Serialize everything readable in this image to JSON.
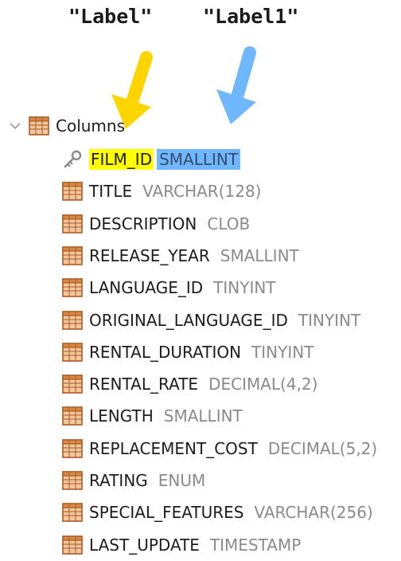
{
  "annotations": {
    "label_left": "\"Label\"",
    "label_right": "\"Label1\""
  },
  "colors": {
    "yellow_arrow": "#ffd400",
    "blue_arrow": "#6fb7ff",
    "yellow_highlight": "#ffff00",
    "blue_highlight": "#6fb7ff",
    "type_text": "#8a8a8a"
  },
  "tree": {
    "root_label": "Columns",
    "root_icon": "table-icon",
    "expanded": true,
    "columns": [
      {
        "name": "FILM_ID",
        "type": "SMALLINT",
        "icon": "key-icon"
      },
      {
        "name": "TITLE",
        "type": "VARCHAR(128)",
        "icon": "column-icon"
      },
      {
        "name": "DESCRIPTION",
        "type": "CLOB",
        "icon": "column-icon"
      },
      {
        "name": "RELEASE_YEAR",
        "type": "SMALLINT",
        "icon": "column-icon"
      },
      {
        "name": "LANGUAGE_ID",
        "type": "TINYINT",
        "icon": "column-icon"
      },
      {
        "name": "ORIGINAL_LANGUAGE_ID",
        "type": "TINYINT",
        "icon": "column-icon"
      },
      {
        "name": "RENTAL_DURATION",
        "type": "TINYINT",
        "icon": "column-icon"
      },
      {
        "name": "RENTAL_RATE",
        "type": "DECIMAL(4,2)",
        "icon": "column-icon"
      },
      {
        "name": "LENGTH",
        "type": "SMALLINT",
        "icon": "column-icon"
      },
      {
        "name": "REPLACEMENT_COST",
        "type": "DECIMAL(5,2)",
        "icon": "column-icon"
      },
      {
        "name": "RATING",
        "type": "ENUM",
        "icon": "column-icon"
      },
      {
        "name": "SPECIAL_FEATURES",
        "type": "VARCHAR(256)",
        "icon": "column-icon"
      },
      {
        "name": "LAST_UPDATE",
        "type": "TIMESTAMP",
        "icon": "column-icon"
      }
    ]
  }
}
